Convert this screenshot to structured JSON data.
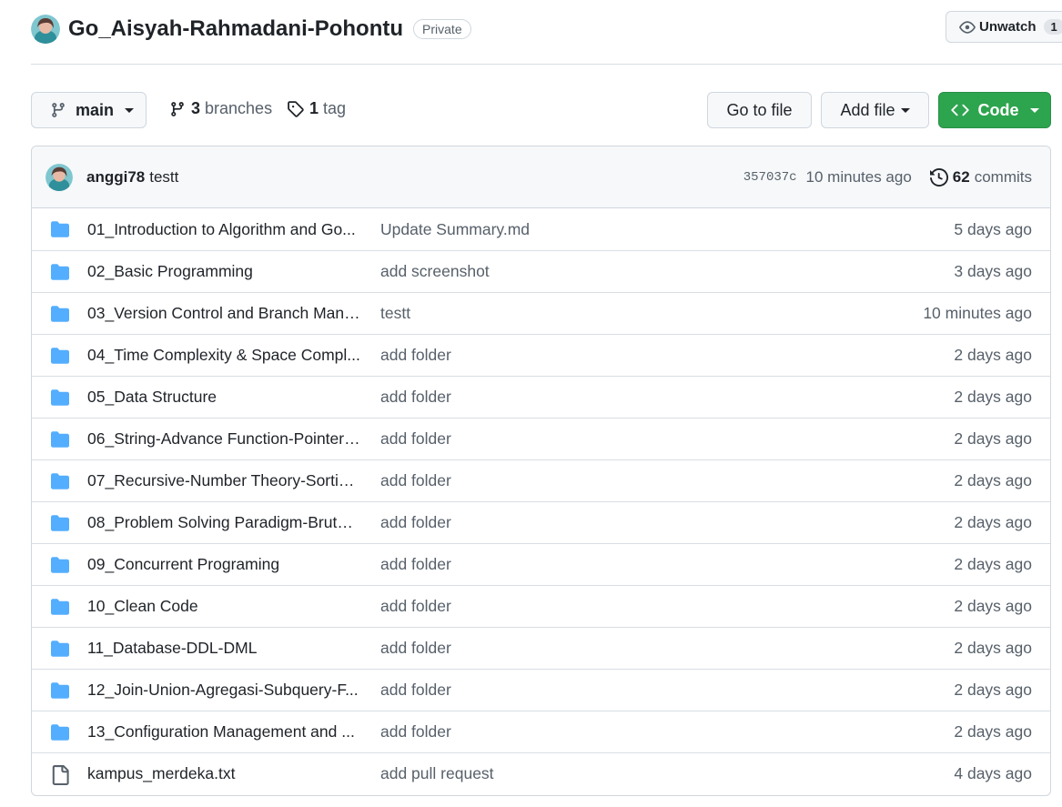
{
  "repo": {
    "name": "Go_Aisyah-Rahmadani-Pohontu",
    "visibility": "Private",
    "unwatch_label": "Unwatch",
    "unwatch_count": "1"
  },
  "toolbar": {
    "branch": "main",
    "branches_count": "3",
    "branches_label": "branches",
    "tags_count": "1",
    "tags_label": "tag",
    "goto_file": "Go to file",
    "add_file": "Add file",
    "code": "Code"
  },
  "latest_commit": {
    "author": "anggi78",
    "message": "testt",
    "sha": "357037c",
    "time": "10 minutes ago",
    "commits_count": "62",
    "commits_label": "commits"
  },
  "files": [
    {
      "name": "01_Introduction to Algorithm and Go...",
      "message": "Update Summary.md",
      "age": "5 days ago",
      "type": "folder"
    },
    {
      "name": "02_Basic Programming",
      "message": "add screenshot",
      "age": "3 days ago",
      "type": "folder"
    },
    {
      "name": "03_Version Control and Branch Mana...",
      "message": "testt",
      "age": "10 minutes ago",
      "type": "folder"
    },
    {
      "name": "04_Time Complexity & Space Compl...",
      "message": "add folder",
      "age": "2 days ago",
      "type": "folder"
    },
    {
      "name": "05_Data Structure",
      "message": "add folder",
      "age": "2 days ago",
      "type": "folder"
    },
    {
      "name": "06_String-Advance Function-Pointer-...",
      "message": "add folder",
      "age": "2 days ago",
      "type": "folder"
    },
    {
      "name": "07_Recursive-Number Theory-Sortin...",
      "message": "add folder",
      "age": "2 days ago",
      "type": "folder"
    },
    {
      "name": "08_Problem Solving Paradigm-Brute ...",
      "message": "add folder",
      "age": "2 days ago",
      "type": "folder"
    },
    {
      "name": "09_Concurrent Programing",
      "message": "add folder",
      "age": "2 days ago",
      "type": "folder"
    },
    {
      "name": "10_Clean Code",
      "message": "add folder",
      "age": "2 days ago",
      "type": "folder"
    },
    {
      "name": "11_Database-DDL-DML",
      "message": "add folder",
      "age": "2 days ago",
      "type": "folder"
    },
    {
      "name": "12_Join-Union-Agregasi-Subquery-F...",
      "message": "add folder",
      "age": "2 days ago",
      "type": "folder"
    },
    {
      "name": "13_Configuration Management and ...",
      "message": "add folder",
      "age": "2 days ago",
      "type": "folder"
    },
    {
      "name": "kampus_merdeka.txt",
      "message": "add pull request",
      "age": "4 days ago",
      "type": "file"
    }
  ],
  "icons": {
    "folder": "folder-icon",
    "file": "file-icon",
    "branch": "git-branch-icon",
    "tag": "tag-icon",
    "history": "history-icon",
    "eye": "eye-icon",
    "code": "code-icon"
  },
  "colors": {
    "folder": "#54aeff",
    "code_button": "#2da44e",
    "muted_text": "#57606a",
    "border": "#d0d7de"
  }
}
